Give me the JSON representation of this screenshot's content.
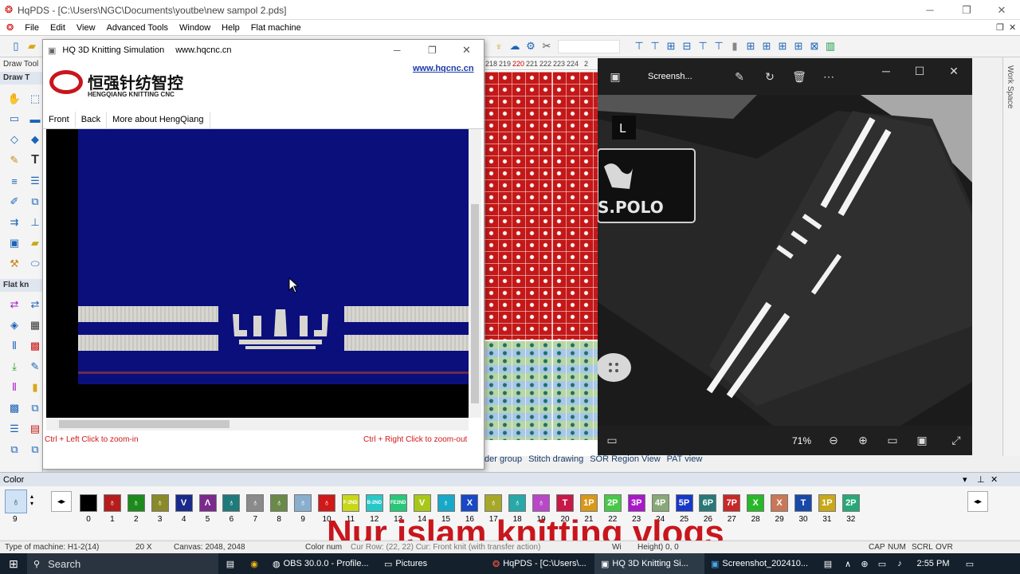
{
  "window": {
    "title": "HqPDS - [C:\\Users\\NGC\\Documents\\youtbe\\new sampol 2.pds]"
  },
  "menu": [
    "File",
    "Edit",
    "View",
    "Advanced Tools",
    "Window",
    "Help",
    "Flat machine"
  ],
  "left_panel": {
    "draw_tools": "Draw Tool",
    "draw_group": "Draw T",
    "flat_group": "Flat kn"
  },
  "sim": {
    "title": "HQ 3D Knitting Simulation",
    "url": "www.hqcnc.cn",
    "link": "www.hqcnc.cn",
    "logo_cn": "恒强针纺智控",
    "logo_en": "HENGQIANG KNITTING CNC",
    "tabs": [
      "Front",
      "Back",
      "More about HengQiang"
    ],
    "hint_left": "Ctrl + Left Click to zoom-in",
    "hint_right": "Ctrl + Right Click to zoom-out"
  },
  "ruler": [
    "218",
    "219",
    "220",
    "221",
    "222",
    "223",
    "224",
    "2"
  ],
  "view_tabs": [
    "der group",
    "Stitch drawing",
    "SOR Region View",
    "PAT view"
  ],
  "photo": {
    "title": "Screensh...",
    "zoom": "71%",
    "label_l": "L",
    "brand": "S.POLO"
  },
  "right_panel": {
    "label": "Work Space"
  },
  "color": {
    "header": "Color",
    "selected": "9",
    "swatches": [
      {
        "n": "0",
        "c": "#000000",
        "g": ""
      },
      {
        "n": "1",
        "c": "#b71c1c",
        "g": "♁"
      },
      {
        "n": "2",
        "c": "#1e8a1e",
        "g": "♁"
      },
      {
        "n": "3",
        "c": "#8a8a2a",
        "g": "♁"
      },
      {
        "n": "4",
        "c": "#1a2a8a",
        "g": "V"
      },
      {
        "n": "5",
        "c": "#7a2a8a",
        "g": "Λ"
      },
      {
        "n": "6",
        "c": "#1f7a7a",
        "g": "♁"
      },
      {
        "n": "7",
        "c": "#8a8a8a",
        "g": "♁"
      },
      {
        "n": "8",
        "c": "#6a8a4a",
        "g": "♁"
      },
      {
        "n": "9",
        "c": "#8aaecd",
        "g": "♁"
      },
      {
        "n": "10",
        "c": "#d01818",
        "g": "♁"
      },
      {
        "n": "11",
        "c": "#c8d818",
        "g": "F-2ND"
      },
      {
        "n": "12",
        "c": "#28c8c8",
        "g": "B-2ND"
      },
      {
        "n": "13",
        "c": "#28c878",
        "g": "FE2ND"
      },
      {
        "n": "14",
        "c": "#a8c818",
        "g": "V"
      },
      {
        "n": "15",
        "c": "#18a8c8",
        "g": "♁"
      },
      {
        "n": "16",
        "c": "#1848c8",
        "g": "X"
      },
      {
        "n": "17",
        "c": "#a8a828",
        "g": "♁"
      },
      {
        "n": "18",
        "c": "#28a8a8",
        "g": "♁"
      },
      {
        "n": "19",
        "c": "#b848c8",
        "g": "♁"
      },
      {
        "n": "20",
        "c": "#c81848",
        "g": "T"
      },
      {
        "n": "21",
        "c": "#d89818",
        "g": "1P"
      },
      {
        "n": "22",
        "c": "#48c848",
        "g": "2P"
      },
      {
        "n": "23",
        "c": "#a818c8",
        "g": "3P"
      },
      {
        "n": "24",
        "c": "#88a878",
        "g": "4P"
      },
      {
        "n": "25",
        "c": "#1838c8",
        "g": "5P"
      },
      {
        "n": "26",
        "c": "#287878",
        "g": "6P"
      },
      {
        "n": "27",
        "c": "#c82828",
        "g": "7P"
      },
      {
        "n": "28",
        "c": "#28b828",
        "g": "X"
      },
      {
        "n": "29",
        "c": "#c87858",
        "g": "X"
      },
      {
        "n": "30",
        "c": "#1848a8",
        "g": "T"
      },
      {
        "n": "31",
        "c": "#c8a818",
        "g": "1P"
      },
      {
        "n": "32",
        "c": "#28a878",
        "g": "2P"
      }
    ]
  },
  "overlay_text": "Nur islam knitting vlogs",
  "status": {
    "machine": "Type of machine: H1-2(14)",
    "zoom": "20 X",
    "canvas": "Canvas: 2048, 2048",
    "color_num": "Color num",
    "cur_row": "Cur Row: (22, 22) Cur: Front knit (with transfer action)",
    "width": "Wi",
    "height": "Height) 0, 0",
    "caps": "CAP",
    "num": "NUM",
    "scrl": "SCRL",
    "ovr": "OVR"
  },
  "taskbar": {
    "search": "Search",
    "items": [
      "OBS 30.0.0 - Profile...",
      "Pictures",
      "HqPDS - [C:\\Users\\...",
      "HQ 3D Knitting Si...",
      "Screenshot_202410..."
    ],
    "time": "2:55 PM"
  }
}
